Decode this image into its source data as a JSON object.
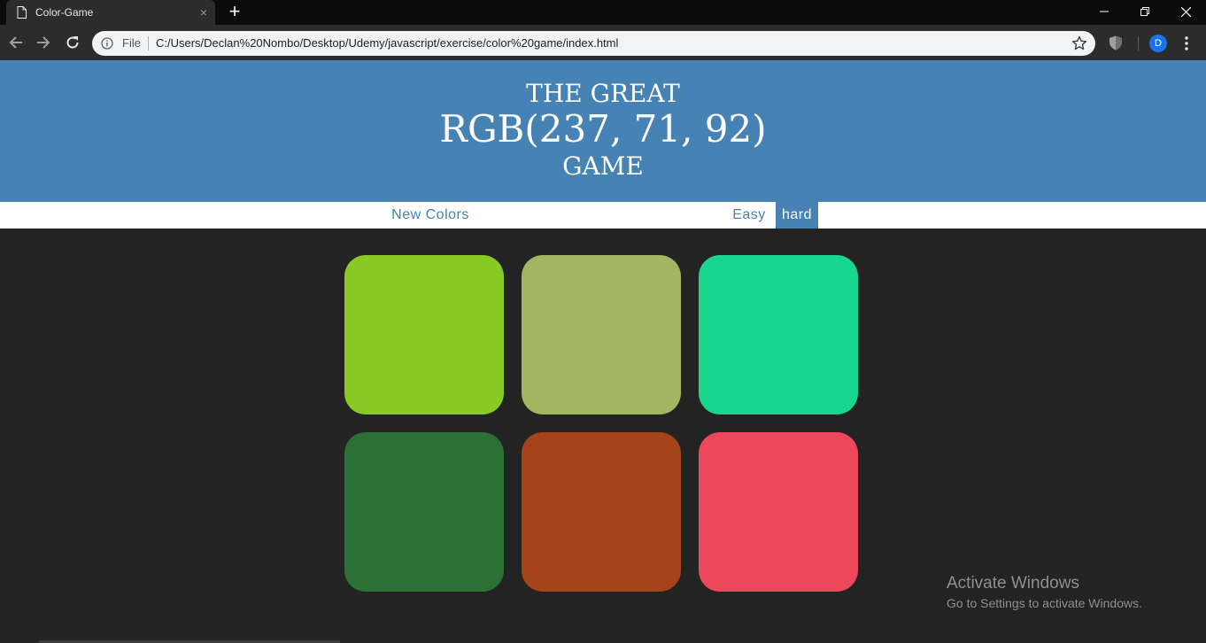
{
  "browser": {
    "tab_title": "Color-Game",
    "tab_close": "×",
    "new_tab": "+",
    "file_label": "File",
    "url": "C:/Users/Declan%20Nombo/Desktop/Udemy/javascript/exercise/color%20game/index.html",
    "profile_initial": "D"
  },
  "header": {
    "line1": "THE GREAT",
    "rgb_display": "RGB(237, 71, 92)",
    "line3": "GAME",
    "background": "#4682b4"
  },
  "controls": {
    "new_colors": "New Colors",
    "easy": "Easy",
    "hard": "hard",
    "selected_mode": "hard"
  },
  "squares": [
    {
      "color": "#89c923"
    },
    {
      "color": "#a0b660"
    },
    {
      "color": "#18d68e"
    },
    {
      "color": "#2b7135"
    },
    {
      "color": "#a5441a"
    },
    {
      "color": "#ed475c"
    }
  ],
  "watermark": {
    "title": "Activate Windows",
    "subtitle": "Go to Settings to activate Windows."
  },
  "icons": {
    "tab_doc": "document-icon",
    "back": "back-arrow-icon",
    "forward": "forward-arrow-icon",
    "reload": "reload-icon",
    "info": "info-icon",
    "star": "star-icon",
    "extension": "shield-icon",
    "menu": "kebab-menu-icon"
  }
}
